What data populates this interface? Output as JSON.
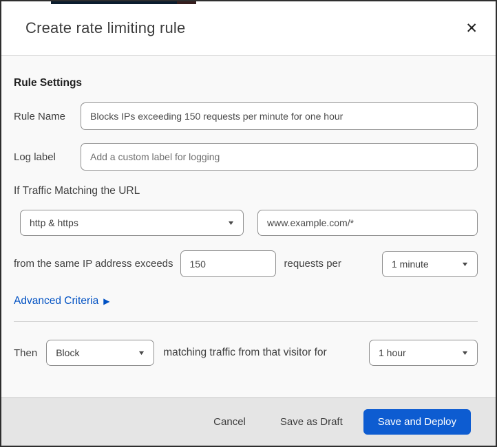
{
  "dialog": {
    "title": "Create rate limiting rule",
    "close_icon": "✕"
  },
  "rule_settings": {
    "heading": "Rule Settings",
    "rule_name": {
      "label": "Rule Name",
      "value": "Blocks IPs exceeding 150 requests per minute for one hour"
    },
    "log_label": {
      "label": "Log label",
      "placeholder": "Add a custom label for logging"
    }
  },
  "match": {
    "heading": "If Traffic Matching the URL",
    "scheme_select": {
      "value": "http & https"
    },
    "url_input": {
      "value": "www.example.com/*"
    },
    "threshold_text_before": "from the same IP address exceeds",
    "requests_input": {
      "value": "150"
    },
    "threshold_text_after": "requests per",
    "period_select": {
      "value": "1 minute"
    },
    "advanced_link": {
      "label": "Advanced Criteria",
      "chevron": "▶"
    }
  },
  "action": {
    "then_label": "Then",
    "action_select": {
      "value": "Block"
    },
    "middle_text": "matching traffic from that visitor for",
    "duration_select": {
      "value": "1 hour"
    }
  },
  "footer": {
    "cancel_label": "Cancel",
    "save_draft_label": "Save as Draft",
    "save_deploy_label": "Save and Deploy"
  },
  "icons": {
    "select_caret": "▼"
  },
  "colors": {
    "link_blue": "#0051c3",
    "primary_button_blue": "#0d5cd1",
    "modal_border": "#2e2e2e"
  }
}
